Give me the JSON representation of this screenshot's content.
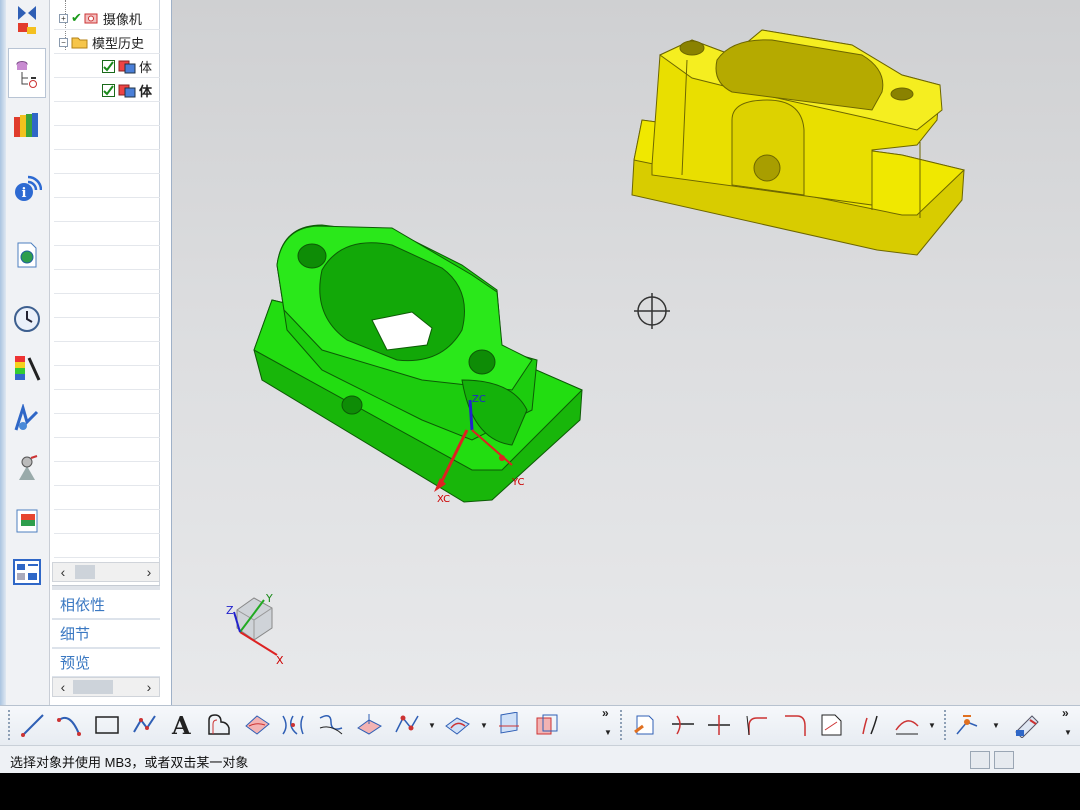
{
  "navigator": {
    "rows": [
      {
        "label": "摄像机",
        "type": "camera"
      },
      {
        "label": "模型历史",
        "type": "folder"
      },
      {
        "label": "体",
        "type": "body"
      },
      {
        "label": "体",
        "type": "body"
      }
    ],
    "sections": [
      "相依性",
      "细节",
      "预览"
    ]
  },
  "viewport": {
    "triad_labels": {
      "x": "X",
      "y": "Y",
      "z": "Z"
    },
    "wcs_labels": {
      "xc": "XC",
      "yc": "YC",
      "zc": "ZC"
    }
  },
  "toolbar": {
    "more": "»"
  },
  "status": {
    "message": "选择对象并使用 MB3，或者双击某一对象"
  },
  "colors": {
    "green_part": "#22dd11",
    "yellow_part": "#f0e800",
    "accent": "#3a78c2"
  }
}
